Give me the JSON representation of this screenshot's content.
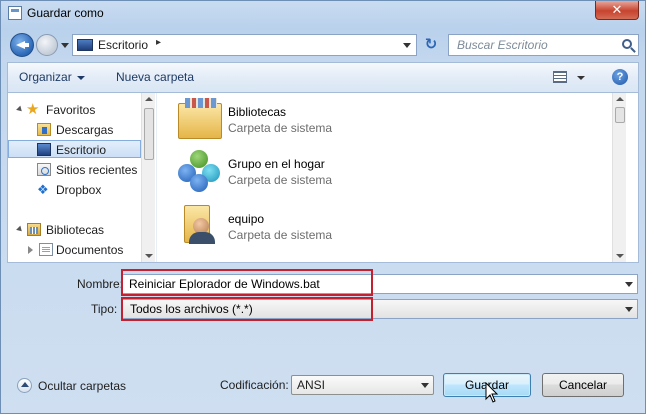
{
  "window": {
    "title": "Guardar como",
    "close_glyph": "✕"
  },
  "address": {
    "location": "Escritorio",
    "chevron": "▸",
    "refresh_glyph": "↻"
  },
  "search": {
    "placeholder": "Buscar Escritorio"
  },
  "toolbar": {
    "organize_label": "Organizar",
    "new_folder_label": "Nueva carpeta",
    "help_glyph": "?"
  },
  "nav": {
    "items": [
      {
        "label": "Favoritos",
        "icon": "star-icon",
        "glyph": "★"
      },
      {
        "label": "Descargas",
        "icon": "downloads-folder-icon"
      },
      {
        "label": "Escritorio",
        "icon": "desktop-icon",
        "selected": true
      },
      {
        "label": "Sitios recientes",
        "icon": "recent-places-icon"
      },
      {
        "label": "Dropbox",
        "icon": "dropbox-icon",
        "glyph": "❖"
      },
      {
        "label": "Bibliotecas",
        "icon": "libraries-icon"
      },
      {
        "label": "Documentos",
        "icon": "documents-icon"
      }
    ]
  },
  "files": [
    {
      "name": "Bibliotecas",
      "desc": "Carpeta de sistema",
      "icon": "libraries-folder-icon"
    },
    {
      "name": "Grupo en el hogar",
      "desc": "Carpeta de sistema",
      "icon": "homegroup-icon"
    },
    {
      "name": "equipo",
      "desc": "Carpeta de sistema",
      "icon": "user-folder-icon"
    }
  ],
  "form": {
    "name_label": "Nombre:",
    "name_value": "Reiniciar Eplorador de Windows.bat",
    "type_label": "Tipo:",
    "type_value": "Todos los archivos  (*.*)"
  },
  "footer": {
    "hide_folders_label": "Ocultar carpetas",
    "encoding_label": "Codificación:",
    "encoding_value": "ANSI",
    "save_label": "Guardar",
    "cancel_label": "Cancelar"
  },
  "colors": {
    "highlight": "#c4202f",
    "accent": "#2c66b5"
  }
}
